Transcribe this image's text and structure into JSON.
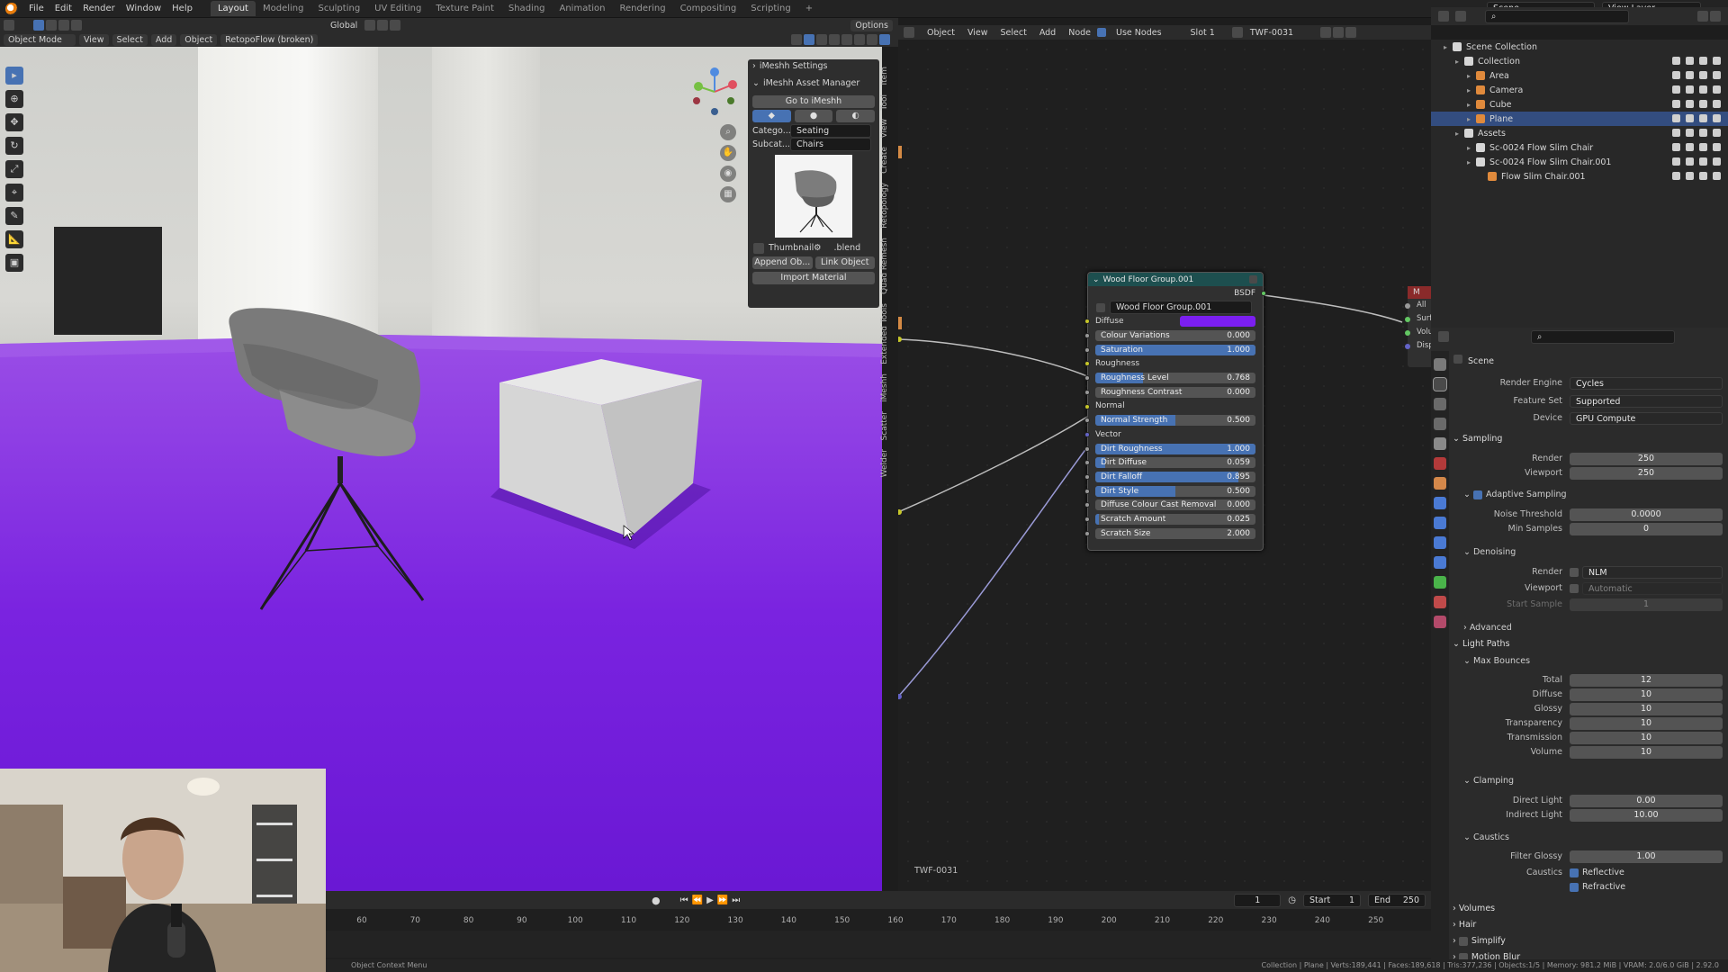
{
  "menu": [
    "File",
    "Edit",
    "Render",
    "Window",
    "Help"
  ],
  "workspaces": [
    "Layout",
    "Modeling",
    "Sculpting",
    "UV Editing",
    "Texture Paint",
    "Shading",
    "Animation",
    "Rendering",
    "Compositing",
    "Scripting"
  ],
  "active_workspace": "Layout",
  "scene_name": "Scene",
  "view_layer": "View Layer",
  "viewport_header": {
    "transform": "Global",
    "options": "Options"
  },
  "viewport_toolbar": {
    "mode": "Object Mode",
    "items": [
      "View",
      "Select",
      "Add",
      "Object"
    ],
    "addon": "RetopoFlow (broken)"
  },
  "meshh": {
    "settings": "iMeshh Settings",
    "asset_manager": "iMeshh Asset Manager",
    "go_to": "Go to iMeshh",
    "category_label": "Catego...",
    "category_value": "Seating",
    "subcategory_label": "Subcat...",
    "subcategory_value": "Chairs",
    "thumbnail": "Thumbnail",
    "blend": ".blend",
    "append": "Append Ob...",
    "link": "Link Object",
    "import_material": "Import Material"
  },
  "side_tabs": [
    "Item",
    "Tool",
    "View",
    "Create",
    "Retopology",
    "Quad Remesh",
    "Extended Tools",
    "iMeshh",
    "Scatter",
    "Welder"
  ],
  "node_header": {
    "type": "Object",
    "items": [
      "View",
      "Select",
      "Add",
      "Node"
    ],
    "use_nodes": "Use Nodes",
    "slot": "Slot 1",
    "material": "TWF-0031"
  },
  "node": {
    "title": "Wood Floor Group.001",
    "output": "BSDF",
    "group": "Wood Floor Group.001",
    "diffuse_color": "#7b1ff0",
    "rows": [
      {
        "type": "label",
        "label": "Diffuse",
        "socket": "yellow"
      },
      {
        "type": "slider",
        "label": "Colour Variations",
        "value": "0.000",
        "fill": 0.0,
        "socket": "gray"
      },
      {
        "type": "slider",
        "label": "Saturation",
        "value": "1.000",
        "fill": 1.0,
        "socket": "gray"
      },
      {
        "type": "label",
        "label": "Roughness",
        "socket": "yellow"
      },
      {
        "type": "slider",
        "label": "Roughness Level",
        "value": "0.768",
        "fill": 0.3,
        "socket": "gray"
      },
      {
        "type": "slider",
        "label": "Roughness Contrast",
        "value": "0.000",
        "fill": 0.0,
        "socket": "gray"
      },
      {
        "type": "label",
        "label": "Normal",
        "socket": "yellow"
      },
      {
        "type": "slider",
        "label": "Normal Strength",
        "value": "0.500",
        "fill": 0.5,
        "socket": "gray"
      },
      {
        "type": "label",
        "label": "Vector",
        "socket": "blue"
      },
      {
        "type": "slider",
        "label": "Dirt Roughness",
        "value": "1.000",
        "fill": 1.0,
        "socket": "gray"
      },
      {
        "type": "slider",
        "label": "Dirt Diffuse",
        "value": "0.059",
        "fill": 0.06,
        "socket": "gray"
      },
      {
        "type": "slider",
        "label": "Dirt Falloff",
        "value": "0.895",
        "fill": 0.895,
        "socket": "gray"
      },
      {
        "type": "slider",
        "label": "Dirt Style",
        "value": "0.500",
        "fill": 0.5,
        "socket": "gray"
      },
      {
        "type": "slider",
        "label": "Diffuse Colour Cast Removal",
        "value": "0.000",
        "fill": 0.0,
        "socket": "gray"
      },
      {
        "type": "slider",
        "label": "Scratch Amount",
        "value": "0.025",
        "fill": 0.025,
        "socket": "gray"
      },
      {
        "type": "slider",
        "label": "Scratch Size",
        "value": "2.000",
        "fill": 0.0,
        "socket": "gray"
      }
    ],
    "material_label": "TWF-0031",
    "output_node_title": "M",
    "output_sockets": [
      "All",
      "Surf",
      "Volu",
      "Disp"
    ]
  },
  "outliner": {
    "rows": [
      {
        "label": "Scene Collection",
        "indent": 0,
        "icon": "#d6d6d6",
        "selected": false,
        "vis": false
      },
      {
        "label": "Collection",
        "indent": 1,
        "icon": "#d6d6d6",
        "selected": false,
        "vis": true
      },
      {
        "label": "Area",
        "indent": 2,
        "icon": "#e08a3c",
        "selected": false,
        "vis": true
      },
      {
        "label": "Camera",
        "indent": 2,
        "icon": "#e08a3c",
        "selected": false,
        "vis": true
      },
      {
        "label": "Cube",
        "indent": 2,
        "icon": "#e08a3c",
        "selected": false,
        "vis": true
      },
      {
        "label": "Plane",
        "indent": 2,
        "icon": "#e08a3c",
        "selected": true,
        "vis": true
      },
      {
        "label": "Assets",
        "indent": 1,
        "icon": "#d6d6d6",
        "selected": false,
        "vis": true
      },
      {
        "label": "Sc-0024 Flow Slim Chair",
        "indent": 2,
        "icon": "#d6d6d6",
        "selected": false,
        "vis": true
      },
      {
        "label": "Sc-0024 Flow Slim Chair.001",
        "indent": 2,
        "icon": "#d6d6d6",
        "selected": false,
        "vis": true
      },
      {
        "label": "Flow Slim Chair.001",
        "indent": 3,
        "icon": "#e08a3c",
        "selected": false,
        "vis": true
      }
    ]
  },
  "properties": {
    "context": "Scene",
    "render_engine_label": "Render Engine",
    "render_engine": "Cycles",
    "feature_set_label": "Feature Set",
    "feature_set": "Supported",
    "device_label": "Device",
    "device": "GPU Compute",
    "sampling": "Sampling",
    "render_label": "Render",
    "render_samples": "250",
    "viewport_label": "Viewport",
    "viewport_samples": "250",
    "adaptive_sampling": "Adaptive Sampling",
    "noise_threshold_label": "Noise Threshold",
    "noise_threshold": "0.0000",
    "min_samples_label": "Min Samples",
    "min_samples": "0",
    "denoising": "Denoising",
    "denoise_render_label": "Render",
    "denoise_render": "NLM",
    "denoise_viewport_label": "Viewport",
    "denoise_viewport": "Automatic",
    "start_sample_label": "Start Sample",
    "start_sample": "1",
    "advanced": "Advanced",
    "light_paths": "Light Paths",
    "max_bounces": "Max Bounces",
    "bounces": [
      {
        "label": "Total",
        "value": "12"
      },
      {
        "label": "Diffuse",
        "value": "10"
      },
      {
        "label": "Glossy",
        "value": "10"
      },
      {
        "label": "Transparency",
        "value": "10"
      },
      {
        "label": "Transmission",
        "value": "10"
      },
      {
        "label": "Volume",
        "value": "10"
      }
    ],
    "clamping": "Clamping",
    "direct_light_label": "Direct Light",
    "direct_light": "0.00",
    "indirect_light_label": "Indirect Light",
    "indirect_light": "10.00",
    "caustics": "Caustics",
    "filter_glossy_label": "Filter Glossy",
    "filter_glossy": "1.00",
    "caustics_label": "Caustics",
    "reflective": "Reflective",
    "refractive": "Refractive",
    "volumes": "Volumes",
    "hair": "Hair",
    "simplify": "Simplify",
    "motion_blur": "Motion Blur"
  },
  "timeline": {
    "current_frame": "1",
    "start_label": "Start",
    "start": "1",
    "end_label": "End",
    "end": "250",
    "ticks": [
      "60",
      "70",
      "80",
      "90",
      "100",
      "110",
      "120",
      "130",
      "140",
      "150",
      "160",
      "170",
      "180",
      "190",
      "200",
      "210",
      "220",
      "230",
      "240",
      "250"
    ]
  },
  "status": {
    "left": "Object Context Menu",
    "right": "Collection | Plane | Verts:189,441 | Faces:189,618 | Tris:377,236 | Objects:1/5 | Memory: 981.2 MiB | VRAM: 2.0/6.0 GiB | 2.92.0"
  }
}
